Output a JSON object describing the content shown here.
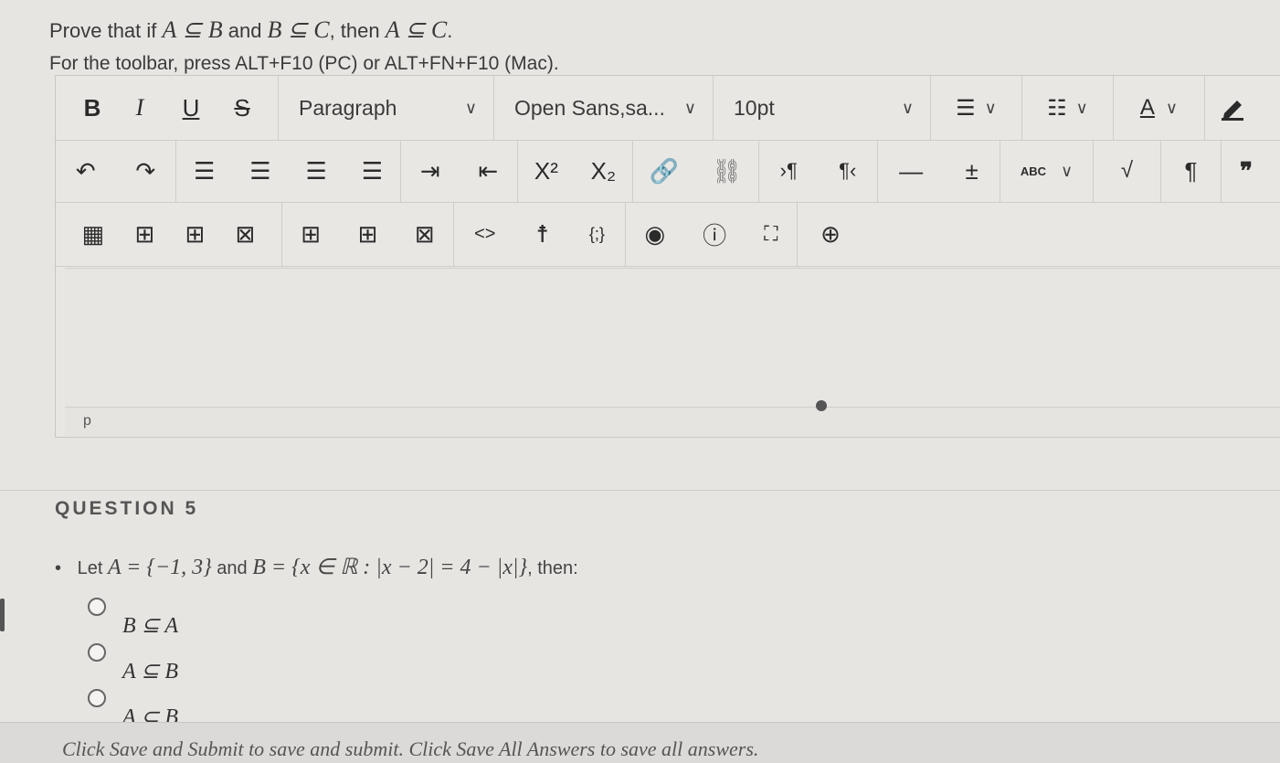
{
  "prompt": {
    "prefix": "Prove that if ",
    "expr1": "A ⊆ B",
    "and": " and ",
    "expr2": "B ⊆ C",
    "then": ", then ",
    "expr3": "A ⊆ C",
    "end": "."
  },
  "toolbar_note": "For the toolbar, press ALT+F10 (PC) or ALT+FN+F10 (Mac).",
  "toolbar": {
    "bold": "B",
    "italic": "I",
    "underline": "U",
    "strike": "S",
    "block_format": "Paragraph",
    "font_family": "Open Sans,sa...",
    "font_size": "10pt",
    "text_color_label": "A",
    "superscript": "X²",
    "subscript": "X₂",
    "ltr": "›¶",
    "rtl": "¶‹",
    "spell": "ABC",
    "pilcrow": "¶",
    "quote": "❞",
    "code": "<>",
    "template": "{;}"
  },
  "editor": {
    "status_path": "p"
  },
  "question": {
    "title": "QUESTION 5",
    "bullet": "•",
    "let": "Let ",
    "set_a": "A = {−1, 3}",
    "and": " and ",
    "set_b": "B = {x ∈ ℝ : |x − 2| = 4 − |x|}",
    "then": ", then:",
    "options": [
      {
        "label": "B ⊆ A"
      },
      {
        "label": "A ⊆ B"
      },
      {
        "label": "A ⊂ B"
      }
    ]
  },
  "footer": "Click Save and Submit to save and submit. Click Save All Answers to save all answers."
}
